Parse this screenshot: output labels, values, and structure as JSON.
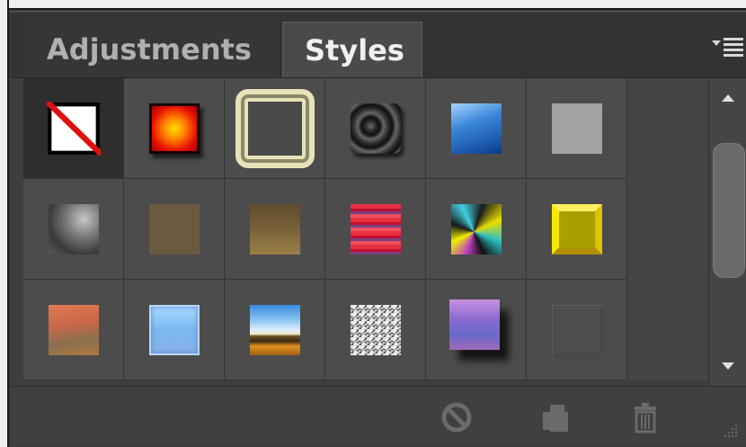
{
  "tabs": {
    "adjustments": "Adjustments",
    "styles": "Styles"
  },
  "panel_menu_icon": "panel-menu-icon",
  "styles_grid": [
    {
      "name": "style-none",
      "icon": "no-style"
    },
    {
      "name": "style-fire-glow",
      "icon": "fire-glow"
    },
    {
      "name": "style-double-ring",
      "icon": "double-ring"
    },
    {
      "name": "style-dark-circles",
      "icon": "dark-circles"
    },
    {
      "name": "style-blue-glass",
      "icon": "blue-glass"
    },
    {
      "name": "style-gray-square",
      "icon": "gray-square"
    },
    {
      "name": "style-gray-metal",
      "icon": "gray-metal"
    },
    {
      "name": "style-brown-flat",
      "icon": "brown-flat"
    },
    {
      "name": "style-brown-gradient",
      "icon": "brown-gradient"
    },
    {
      "name": "style-red-stripes",
      "icon": "red-stripes"
    },
    {
      "name": "style-color-swirl",
      "icon": "color-swirl"
    },
    {
      "name": "style-gold-bevel",
      "icon": "gold-bevel"
    },
    {
      "name": "style-sunset",
      "icon": "sunset"
    },
    {
      "name": "style-light-blue",
      "icon": "light-blue"
    },
    {
      "name": "style-sky-landscape",
      "icon": "sky-landscape"
    },
    {
      "name": "style-noise-texture",
      "icon": "noise-texture"
    },
    {
      "name": "style-purple-shadow",
      "icon": "purple-shadow"
    },
    {
      "name": "style-dark-gray",
      "icon": "dark-gray"
    }
  ],
  "bottom_icons": [
    "clear-style-icon",
    "new-style-icon",
    "trash-icon"
  ]
}
